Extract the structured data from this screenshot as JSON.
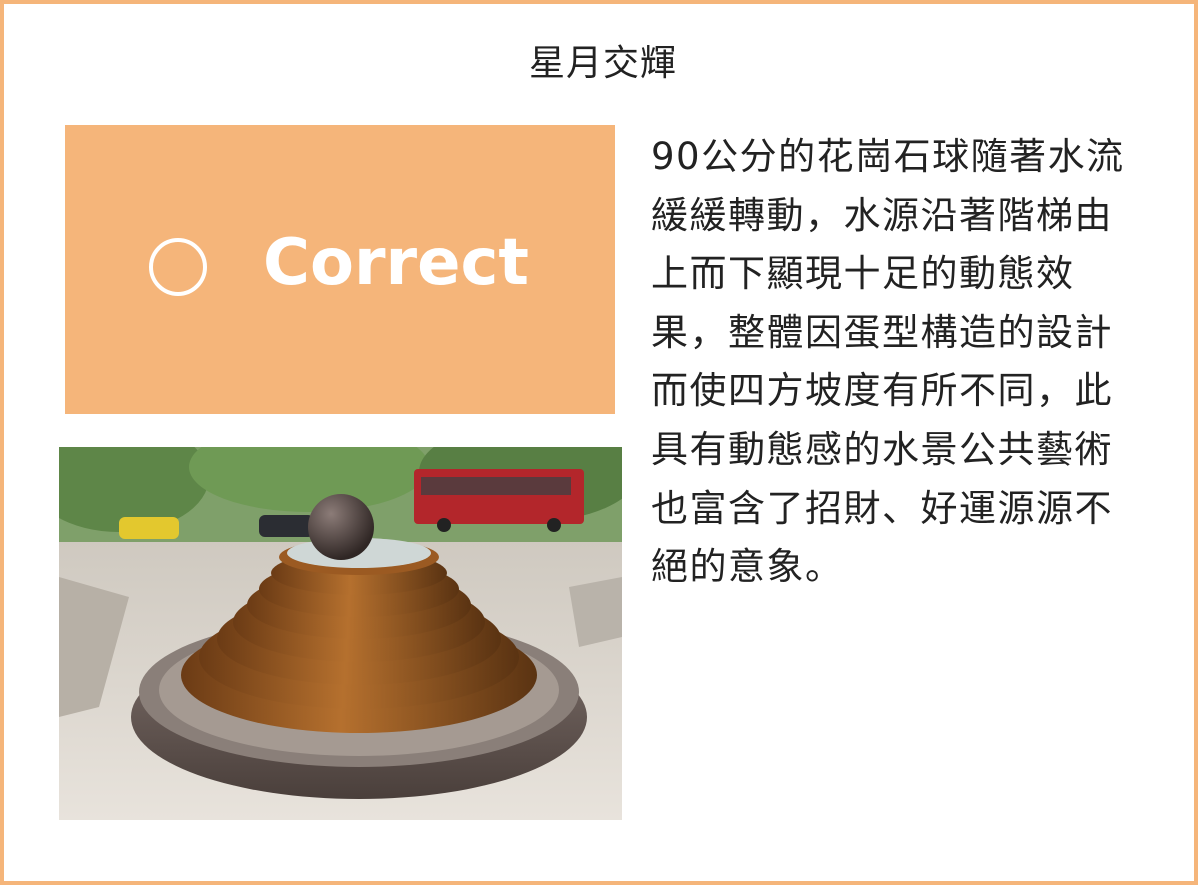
{
  "title": "星月交輝",
  "answer": {
    "label": "Correct",
    "symbol": "circle-icon",
    "box_color": "#f5b57a",
    "text_color": "#ffffff"
  },
  "description": "90公分的花崗石球隨著水流緩緩轉動，水源沿著階梯由上而下顯現十足的動態效果，整體因蛋型構造的設計而使四方坡度有所不同，此具有動態感的水景公共藝術也富含了招財、好運源源不絕的意象。",
  "photo": {
    "subject": "granite sphere fountain on stepped circular basin"
  },
  "colors": {
    "border": "#f5b57a"
  }
}
